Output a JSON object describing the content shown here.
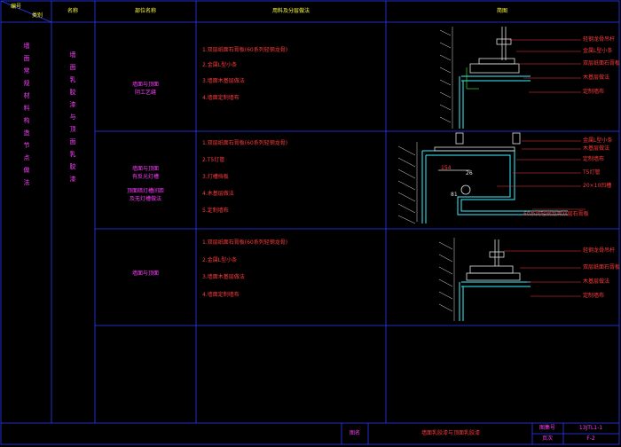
{
  "header": {
    "no": "编号",
    "category": "类别",
    "name": "名称",
    "part_name": "部位名称",
    "materials": "用料及分层做法",
    "diagram": "简图"
  },
  "vertical": {
    "category_text": "墙面常规材料构造节点做法",
    "name_text": "墙面乳胶漆与顶面乳胶漆"
  },
  "rows": [
    {
      "part": [
        "墙面与顶面",
        "阴工艺缝"
      ],
      "steps": [
        "1.双层纸面石膏板(60系列轻钢龙骨)",
        "2.金属L型小条",
        "3.墙面木基层做法",
        "4.墙面定制墙布"
      ],
      "callouts": [
        "轻钢龙骨吊杆",
        "金属L型小条",
        "双层纸面石膏板",
        "木基层做法",
        "定制墙布"
      ]
    },
    {
      "part": [
        "墙面与顶面",
        "有反光灯槽",
        "顶面暗灯槽间距",
        "及无灯槽做法"
      ],
      "steps": [
        "1.双层纸面石膏板(60系列轻钢龙骨)",
        "2.T5灯管",
        "3.灯槽挡板",
        "4.木基层做法",
        "5.定制墙布"
      ],
      "callouts": [
        "金属L型小条",
        "木基层做法",
        "定制墙布",
        "T5灯管",
        "20×10凹槽",
        "60系列轻钢龙骨双层石膏板"
      ],
      "dims": [
        "154",
        "26",
        "81"
      ]
    },
    {
      "part": [
        "墙面与顶面"
      ],
      "steps": [
        "1.双层纸面石膏板(60系列轻钢龙骨)",
        "2.金属L型小条",
        "3.墙面木基层做法",
        "4.墙面定制墙布"
      ],
      "callouts": [
        "轻钢龙骨吊杆",
        "双层纸面石膏板",
        "木基层做法",
        "定制墙布"
      ]
    }
  ],
  "titleblock": {
    "drawing_name_label": "图名",
    "drawing_name": "墙面乳胶漆与顶面乳胶漆",
    "drawing_no_label": "图集号",
    "drawing_no": "13JTL1-1",
    "page_label": "页次",
    "page": "F-2"
  },
  "colors": {
    "grid": "#2a3cff",
    "text": "#ff3b3b",
    "magenta": "#ff3bff",
    "green": "#39ff39",
    "cyan": "#3bf0ff",
    "yellow": "#ffff3b",
    "white": "#e0e0e0"
  }
}
